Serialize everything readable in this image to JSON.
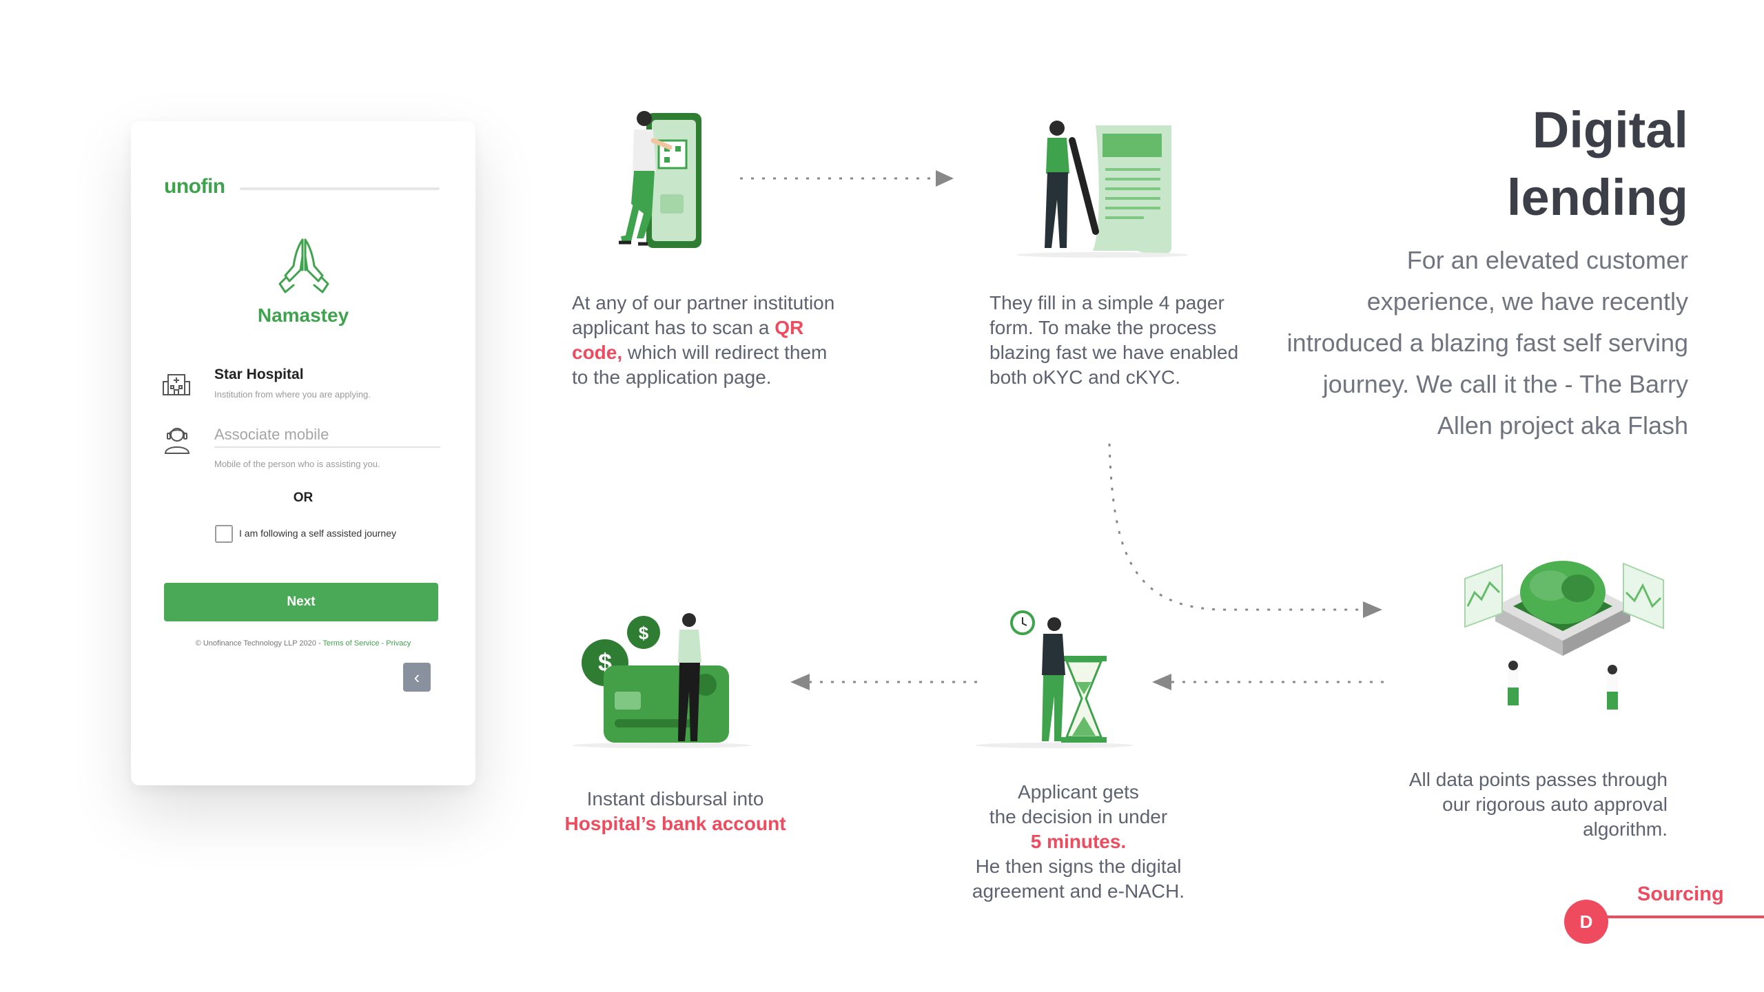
{
  "phone": {
    "logo": "unofin",
    "greeting": "Namastey",
    "institution_name": "Star Hospital",
    "institution_help": "Institution from where you are applying.",
    "mobile_placeholder": "Associate mobile",
    "mobile_help": "Mobile of the person who is assisting you.",
    "or_label": "OR",
    "self_assisted_label": "I am following a self assisted journey",
    "self_assisted_checked": false,
    "next_label": "Next",
    "footer_copyright": "© Unofinance Technology LLP 2020 - ",
    "footer_terms": "Terms of Service",
    "footer_sep": " - ",
    "footer_privacy": "Privacy",
    "back_icon": "chevron-left-icon"
  },
  "heading": {
    "line1": "Digital",
    "line2": "lending"
  },
  "intro": "For an elevated customer experience, we have recently introduced a blazing fast self serving journey. We call it the - The Barry Allen project aka Flash",
  "steps": {
    "step1": {
      "pre": "At any of our partner institution applicant has to scan a ",
      "highlight": "QR code,",
      "post": " which will redirect them to the application page."
    },
    "step2": {
      "text": "They fill in a simple 4 pager form. To make the process blazing fast we have enabled both oKYC and cKYC."
    },
    "step3": {
      "text": "All data points passes through our rigorous auto approval algorithm."
    },
    "step4": {
      "line1": "Applicant gets",
      "line2": "the decision in under",
      "highlight": "5 minutes.",
      "line3": "He then signs the digital",
      "line4": "agreement and e-NACH."
    },
    "step5": {
      "line1": "Instant disbursal into",
      "highlight": "Hospital’s bank account"
    }
  },
  "section": {
    "badge": "D",
    "label": "Sourcing"
  },
  "colors": {
    "brand_green": "#3fa34d",
    "accent_red": "#ef4b5e",
    "heading": "#3c3f47",
    "body_text": "#5e6270"
  }
}
